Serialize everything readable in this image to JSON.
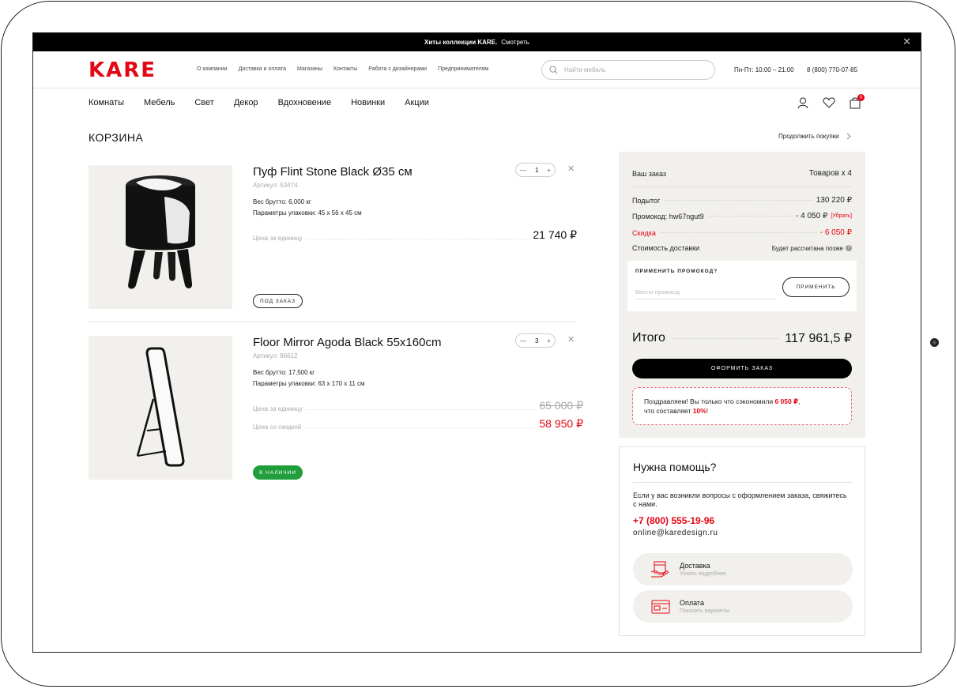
{
  "promo_bar": {
    "title": "Хиты коллекции KARE.",
    "link": "Смотреть",
    "close": "✕"
  },
  "header": {
    "logo": "KARE",
    "nav": [
      "О компании",
      "Доставка и оплата",
      "Магазины",
      "Контакты",
      "Работа с дизайнерами",
      "Предпринимателям"
    ],
    "search_placeholder": "Найти мебель",
    "hours": "Пн-Пт: 10:00 – 21:00",
    "phone": "8 (800) 770-07-85"
  },
  "main_nav": [
    "Комнаты",
    "Мебель",
    "Свет",
    "Декор",
    "Вдохновение",
    "Новинки",
    "Акции"
  ],
  "cart_count": "0",
  "page": {
    "title": "КОРЗИНА",
    "continue": "Продолжить покупки"
  },
  "items": [
    {
      "name": "Пуф Flint Stone Black Ø35 см",
      "article": "Артикул: 53474",
      "weight": "Вес брутто: 6,000 кг",
      "pack": "Параметры упаковки: 45 х 56 х 45 см",
      "qty": "1",
      "unit_label": "Цена за единицу",
      "unit_price": "21 740 ₽",
      "badge": "ПОД ЗАКАЗ"
    },
    {
      "name": "Floor Mirror Agoda Black 55x160cm",
      "article": "Артикул: 86612",
      "weight": "Вес брутто: 17,500 кг",
      "pack": "Параметры упаковки: 63 х 170 х 11 см",
      "qty": "3",
      "unit_label": "Цена за единицу",
      "unit_price": "65 000 ₽",
      "discount_label": "Цена со скидкой",
      "discount_price": "58 950 ₽",
      "badge": "В НАЛИЧИИ"
    }
  ],
  "qty_controls": {
    "minus": "—",
    "plus": "+",
    "remove": "✕"
  },
  "summary": {
    "title": "Ваш заказ",
    "count": "Товаров x 4",
    "subtotal_label": "Подытог",
    "subtotal": "130 220 ₽",
    "promo_label": "Промокод: hw67ngut9",
    "promo_value": "- 4 050 ₽",
    "promo_remove": "[Убрать]",
    "discount_label": "Скидка",
    "discount": "- 6 050 ₽",
    "delivery_label": "Стоимость доставки",
    "delivery": "Будет рассчитана позже",
    "info": "?",
    "promo_box_title": "ПРИМЕНИТЬ ПРОМОКОД?",
    "promo_placeholder": "Ввести промокод",
    "apply": "ПРИМЕНИТЬ",
    "total_label": "Итого",
    "total": "117 961,5 ₽",
    "checkout": "ОФОРМИТЬ ЗАКАЗ",
    "congrats_1": "Поздравляем! Вы только что сэкономили ",
    "congrats_amount": "6 050 ₽",
    "congrats_2": ",",
    "congrats_3": "что составляет ",
    "congrats_percent": "10%",
    "congrats_4": "!"
  },
  "help": {
    "title": "Нужна помощь?",
    "text": "Если у вас возникли вопросы с оформлением заказа, свяжитесь с нами.",
    "phone": "+7 (800) 555-19-96",
    "email": "online@karedesign.ru",
    "cards": [
      {
        "title": "Доставка",
        "subtitle": "Узнать подробнее",
        "icon": "delivery-icon"
      },
      {
        "title": "Оплата",
        "subtitle": "Показать варианты",
        "icon": "payment-card-icon"
      }
    ]
  },
  "colors": {
    "brand": "#e30613",
    "stock": "#1f9e3b",
    "panel": "#f1f0ec"
  }
}
